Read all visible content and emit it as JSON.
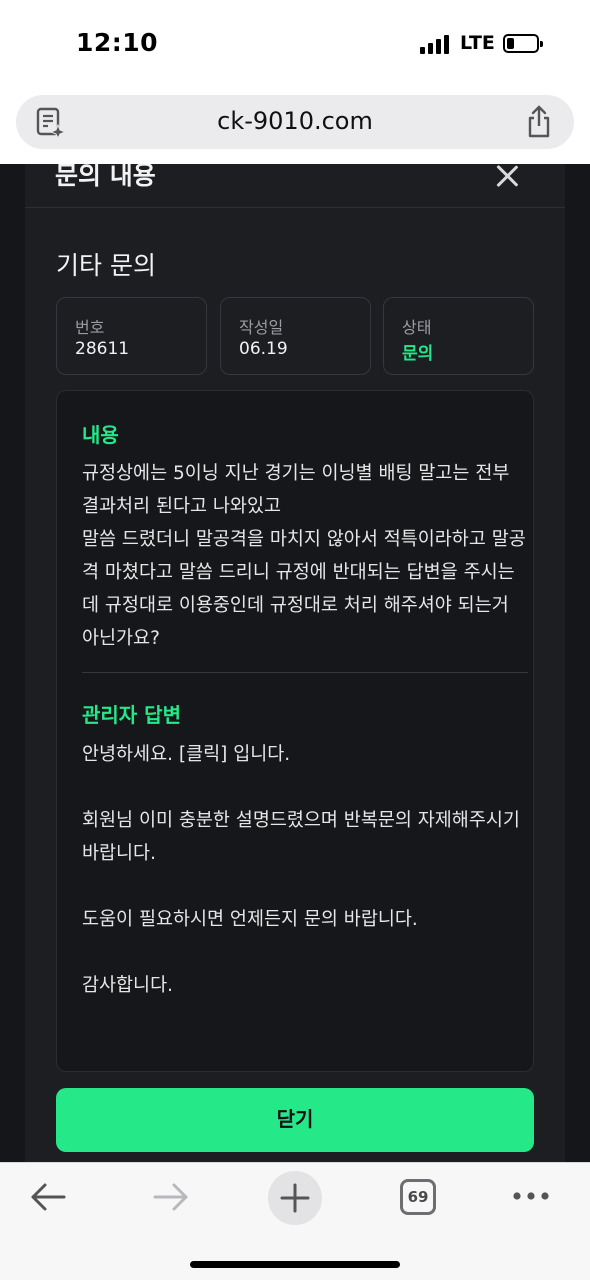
{
  "status_bar": {
    "time": "12:10",
    "network": "LTE"
  },
  "browser": {
    "url": "ck-9010.com",
    "tabs_count": "69"
  },
  "modal": {
    "title": "문의 내용",
    "category": "기타 문의",
    "info": [
      {
        "label": "번호",
        "value": "28611"
      },
      {
        "label": "작성일",
        "value": "06.19"
      },
      {
        "label": "상태",
        "value": "문의"
      }
    ],
    "content_label": "내용",
    "content_text": "규정상에는 5이닝 지난 경기는 이닝별 배팅 말고는 전부 결과처리 된다고 나와있고\n말씀 드렸더니 말공격을 마치지 않아서 적특이라하고 말공격 마쳤다고 말씀 드리니 규정에 반대되는 답변을 주시는데 규정대로 이용중인데 규정대로 처리 해주셔야 되는거 아닌가요?",
    "answer_label": "관리자 답변",
    "answer_text": "안녕하세요. [클릭] 입니다.\n\n회원님 이미 충분한 설명드렸으며 반복문의 자제해주시기 바랍니다.\n\n도움이 필요하시면 언제든지 문의 바랍니다.\n\n감사합니다.",
    "close_button": "닫기"
  },
  "colors": {
    "accent": "#25e889",
    "background": "#1c1e22"
  },
  "icons": [
    "reader-icon",
    "share-icon",
    "close-icon",
    "back-arrow-icon",
    "forward-arrow-icon",
    "new-tab-plus-icon",
    "tabs-icon",
    "more-icon"
  ]
}
